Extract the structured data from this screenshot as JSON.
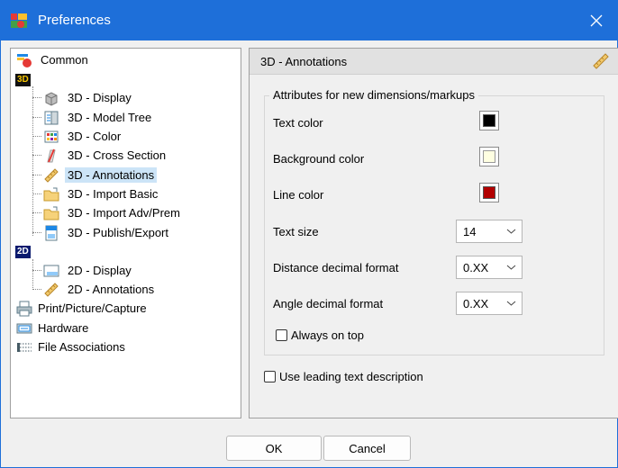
{
  "window": {
    "title": "Preferences"
  },
  "tree": {
    "common": "Common",
    "group3d_badge": "3D",
    "items3d": [
      {
        "label": "3D - Display",
        "icon": "cube-icon"
      },
      {
        "label": "3D - Model Tree",
        "icon": "model-tree-icon"
      },
      {
        "label": "3D - Color",
        "icon": "color-palette-icon"
      },
      {
        "label": "3D - Cross Section",
        "icon": "cross-section-icon"
      },
      {
        "label": "3D - Annotations",
        "icon": "ruler-icon"
      },
      {
        "label": "3D - Import Basic",
        "icon": "folder-import-icon"
      },
      {
        "label": "3D - Import Adv/Prem",
        "icon": "folder-import-icon"
      },
      {
        "label": "3D - Publish/Export",
        "icon": "publish-icon"
      }
    ],
    "group2d_badge": "2D",
    "items2d": [
      {
        "label": "2D - Display",
        "icon": "display-2d-icon"
      },
      {
        "label": "2D - Annotations",
        "icon": "ruler-icon"
      }
    ],
    "print": "Print/Picture/Capture",
    "hardware": "Hardware",
    "file_assoc": "File Associations"
  },
  "panel": {
    "title": "3D - Annotations",
    "group_title": "Attributes for new dimensions/markups",
    "text_color_label": "Text color",
    "text_color": "#000000",
    "bg_color_label": "Background color",
    "bg_color": "#ffffe1",
    "line_color_label": "Line color",
    "line_color": "#b20000",
    "text_size_label": "Text size",
    "text_size": "14",
    "distance_label": "Distance decimal format",
    "distance_format": "0.XX",
    "angle_label": "Angle decimal format",
    "angle_format": "0.XX",
    "always_on_top": "Always on top",
    "leading_text": "Use leading text description"
  },
  "buttons": {
    "ok": "OK",
    "cancel": "Cancel"
  }
}
